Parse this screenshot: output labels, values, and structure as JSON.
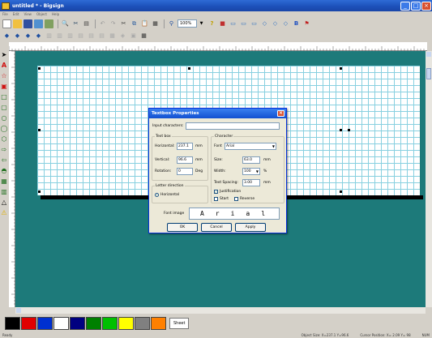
{
  "window": {
    "title": "untitled * - Bigsign"
  },
  "menu": [
    "File",
    "Edit",
    "View",
    "Object",
    "Help"
  ],
  "toolbar": {
    "zoom_value": "100%"
  },
  "palette": {
    "colors": [
      "#000000",
      "#e00000",
      "#0030d0",
      "#ffffff",
      "#000080",
      "#008000",
      "#00c000",
      "#ffff00",
      "#808080",
      "#ff8000"
    ],
    "sheet_label": "Sheet"
  },
  "status": {
    "left": "Ready",
    "object_size": "Object Size: X=237.1 Y=96.6",
    "cursor_position": "Cursor Position: X= 2.09 Y= 98",
    "num": "NUM"
  },
  "dialog": {
    "title": "Textbox Properties",
    "input_label": "Input characters:",
    "input_value": "",
    "textbox_group": "Text box",
    "horizontal_label": "Horizontal:",
    "horizontal_value": "237.1",
    "vertical_label": "Vertical:",
    "vertical_value": "96.6",
    "rotation_label": "Rotation:",
    "rotation_value": "0",
    "unit_mm": "mm",
    "unit_deg": "Deg",
    "letter_direction_group": "Letter direction",
    "horizontal_option": "Horizontal",
    "character_group": "Character",
    "font_label": "Font",
    "font_value": "Arial",
    "size_label": "Size:",
    "size_value": "63.0",
    "width_label": "Width:",
    "width_value": "100",
    "percent": "%",
    "spacing_label": "Text Spacing:",
    "spacing_value": "3.00",
    "justification_label": "Justification",
    "start_label": "Start",
    "reverse_label": "Reverse",
    "font_image_label": "Font image",
    "font_image_text": "Arial",
    "ok_label": "OK",
    "cancel_label": "Cancel",
    "apply_label": "Apply"
  }
}
